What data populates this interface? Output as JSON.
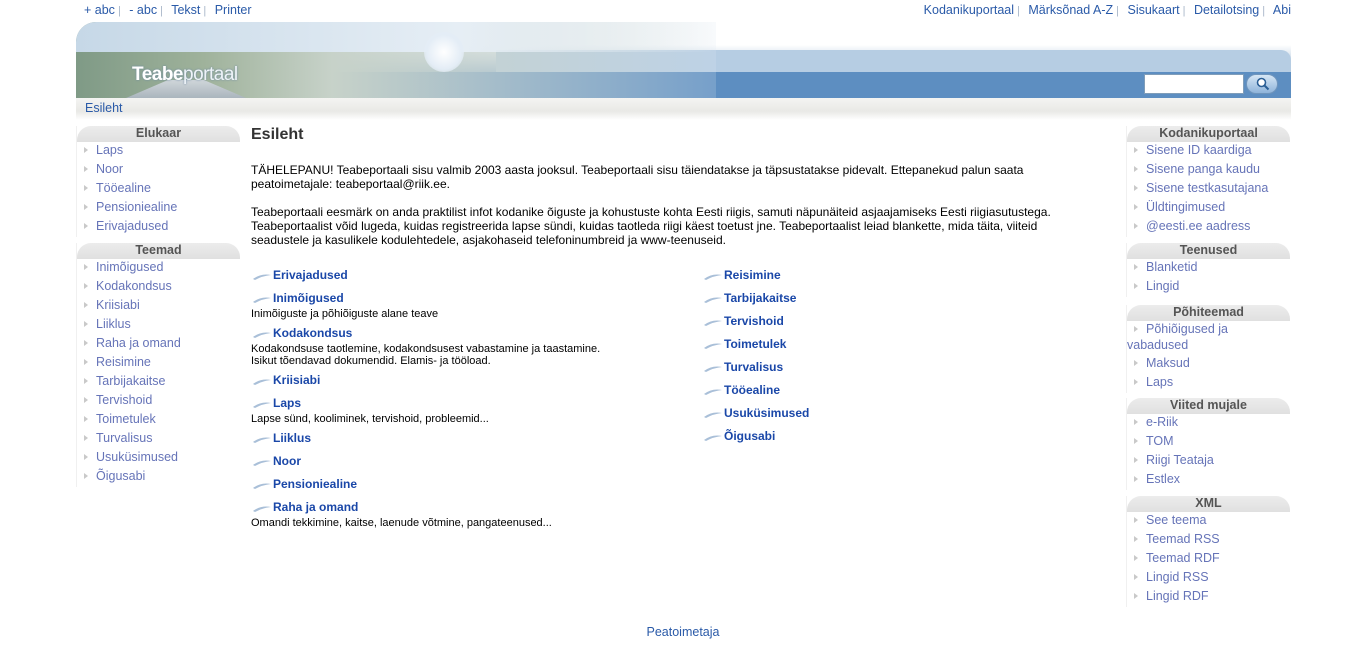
{
  "topbar": {
    "left": [
      "+ abc",
      "- abc",
      "Tekst",
      "Printer"
    ],
    "right": [
      "Kodanikuportaal",
      "Märksõnad A-Z",
      "Sisukaart",
      "Detailotsing",
      "Abi"
    ]
  },
  "banner": {
    "logo_bold": "Teabe",
    "logo_rest": "portaal",
    "search_value": ""
  },
  "breadcrumb": "Esileht",
  "left_sidebar": [
    {
      "title": "Elukaar",
      "items": [
        "Laps",
        "Noor",
        "Tööealine",
        "Pensioniealine",
        "Erivajadused"
      ]
    },
    {
      "title": "Teemad",
      "items": [
        "Inimõigused",
        "Kodakondsus",
        "Kriisiabi",
        "Liiklus",
        "Raha ja omand",
        "Reisimine",
        "Tarbijakaitse",
        "Tervishoid",
        "Toimetulek",
        "Turvalisus",
        "Usuküsimused",
        "Õigusabi"
      ]
    }
  ],
  "right_sidebar": [
    {
      "title": "Kodanikuportaal",
      "items": [
        "Sisene ID kaardiga",
        "Sisene panga kaudu",
        "Sisene testkasutajana",
        "Üldtingimused",
        "@eesti.ee aadress"
      ]
    },
    {
      "title": "Teenused",
      "items": [
        "Blanketid",
        "Lingid"
      ]
    },
    {
      "title": "Põhiteemad",
      "items": [
        "Põhiõigused ja vabadused",
        "Maksud",
        "Laps"
      ]
    },
    {
      "title": "Viited mujale",
      "items": [
        "e-Riik",
        "TOM",
        "Riigi Teataja",
        "Estlex"
      ]
    },
    {
      "title": "XML",
      "items": [
        "See teema",
        "Teemad RSS",
        "Teemad RDF",
        "Lingid RSS",
        "Lingid RDF"
      ]
    }
  ],
  "main": {
    "title": "Esileht",
    "notice": "TÄHELEPANU! Teabeportaali sisu valmib 2003 aasta jooksul. Teabeportaali sisu täiendatakse ja täpsustatakse pidevalt. Ettepanekud palun saata peatoimetajale: teabeportaal@riik.ee.",
    "intro": "Teabeportaali eesmärk on anda praktilist infot kodanike õiguste ja kohustuste kohta Eesti riigis, samuti näpunäiteid asjaajamiseks Eesti riigiasutustega. Teabeportaalist võid lugeda, kuidas registreerida lapse sündi, kuidas taotleda riigi käest toetust jne. Teabeportaalist leiad blankette, mida täita, viiteid seadustele ja kasulikele kodulehtedele, asjakohaseid telefoninumbreid ja www-teenuseid.",
    "topics_left": [
      {
        "label": "Erivajadused",
        "desc": ""
      },
      {
        "label": "Inimõigused",
        "desc": "Inimõiguste ja põhiõiguste alane teave"
      },
      {
        "label": "Kodakondsus",
        "desc": "Kodakondsuse taotlemine, kodakondsusest vabastamine ja taastamine. Isikut tõendavad dokumendid. Elamis- ja tööload."
      },
      {
        "label": "Kriisiabi",
        "desc": ""
      },
      {
        "label": "Laps",
        "desc": "Lapse sünd, kooliminek, tervishoid, probleemid..."
      },
      {
        "label": "Liiklus",
        "desc": ""
      },
      {
        "label": "Noor",
        "desc": ""
      },
      {
        "label": "Pensioniealine",
        "desc": ""
      },
      {
        "label": "Raha ja omand",
        "desc": "Omandi tekkimine, kaitse, laenude võtmine, pangateenused..."
      }
    ],
    "topics_right": [
      {
        "label": "Reisimine"
      },
      {
        "label": "Tarbijakaitse"
      },
      {
        "label": "Tervishoid"
      },
      {
        "label": "Toimetulek"
      },
      {
        "label": "Turvalisus"
      },
      {
        "label": "Tööealine"
      },
      {
        "label": "Usuküsimused"
      },
      {
        "label": "Õigusabi"
      }
    ]
  },
  "footer": "Peatoimetaja"
}
